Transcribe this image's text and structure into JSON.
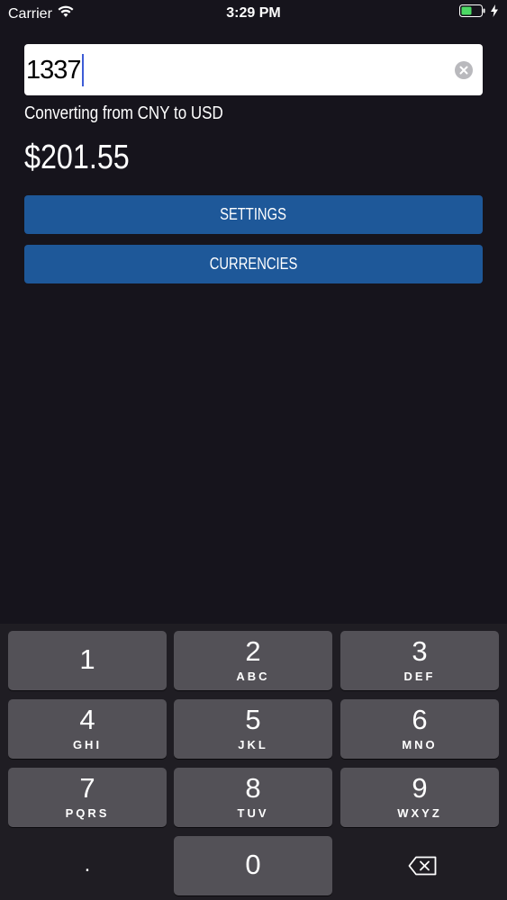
{
  "status_bar": {
    "carrier": "Carrier",
    "time": "3:29 PM"
  },
  "amount_input": {
    "value": "1337"
  },
  "conversion": {
    "label": "Converting from CNY to USD",
    "result": "$201.55"
  },
  "buttons": {
    "settings": "SETTINGS",
    "currencies": "CURRENCIES"
  },
  "keypad": {
    "keys": [
      {
        "digit": "1",
        "letters": ""
      },
      {
        "digit": "2",
        "letters": "ABC"
      },
      {
        "digit": "3",
        "letters": "DEF"
      },
      {
        "digit": "4",
        "letters": "GHI"
      },
      {
        "digit": "5",
        "letters": "JKL"
      },
      {
        "digit": "6",
        "letters": "MNO"
      },
      {
        "digit": "7",
        "letters": "PQRS"
      },
      {
        "digit": "8",
        "letters": "TUV"
      },
      {
        "digit": "9",
        "letters": "WXYZ"
      },
      {
        "digit": "0",
        "letters": ""
      }
    ],
    "decimal": ".",
    "delete_icon": "backspace-icon"
  },
  "colors": {
    "background": "#16141c",
    "button": "#1e5899",
    "key": "#535157",
    "battery": "#4cd964"
  }
}
